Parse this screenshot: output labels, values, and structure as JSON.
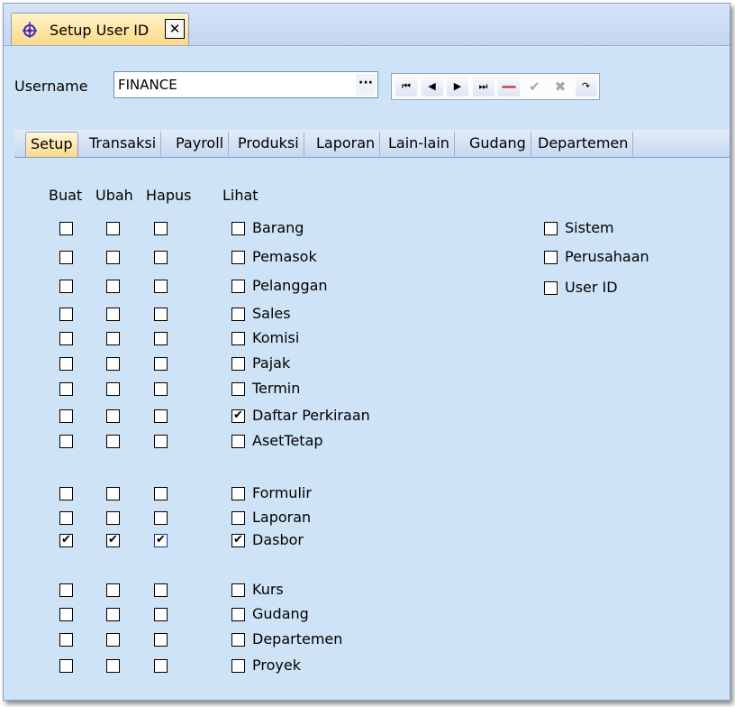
{
  "window": {
    "tab_title": "Setup User ID",
    "close_label": "✕"
  },
  "username": {
    "label": "Username",
    "value": "FINANCE",
    "lookup_label": "···"
  },
  "nav_buttons": [
    {
      "name": "first-record-button",
      "glyph": "⏮",
      "enabled": true
    },
    {
      "name": "prev-record-button",
      "glyph": "◀",
      "enabled": true
    },
    {
      "name": "next-record-button",
      "glyph": "▶",
      "enabled": true
    },
    {
      "name": "last-record-button",
      "glyph": "⏭",
      "enabled": true
    },
    {
      "name": "delete-record-button",
      "glyph": "—",
      "enabled": true
    },
    {
      "name": "save-record-button",
      "glyph": "✔",
      "enabled": false
    },
    {
      "name": "cancel-edit-button",
      "glyph": "✖",
      "enabled": false
    },
    {
      "name": "refresh-button",
      "glyph": "↷",
      "enabled": true
    }
  ],
  "tabs": [
    "Setup",
    "Transaksi",
    "Payroll",
    "Produksi",
    "Laporan",
    "Lain-lain",
    "Gudang",
    "Departemen"
  ],
  "active_tab": "Setup",
  "columns": {
    "buat": "Buat",
    "ubah": "Ubah",
    "hapus": "Hapus",
    "lihat": "Lihat"
  },
  "permissions": [
    {
      "label": "Barang",
      "buat": false,
      "ubah": false,
      "hapus": false,
      "lihat": false
    },
    {
      "label": "Pemasok",
      "buat": false,
      "ubah": false,
      "hapus": false,
      "lihat": false
    },
    {
      "label": "Pelanggan",
      "buat": false,
      "ubah": false,
      "hapus": false,
      "lihat": false
    },
    {
      "label": "Sales",
      "buat": false,
      "ubah": false,
      "hapus": false,
      "lihat": false
    },
    {
      "label": "Komisi",
      "buat": false,
      "ubah": false,
      "hapus": false,
      "lihat": false
    },
    {
      "label": "Pajak",
      "buat": false,
      "ubah": false,
      "hapus": false,
      "lihat": false
    },
    {
      "label": "Termin",
      "buat": false,
      "ubah": false,
      "hapus": false,
      "lihat": false
    },
    {
      "label": "Daftar Perkiraan",
      "buat": false,
      "ubah": false,
      "hapus": false,
      "lihat": true
    },
    {
      "label": "AsetTetap",
      "buat": false,
      "ubah": false,
      "hapus": false,
      "lihat": false
    },
    {
      "label": "Formulir",
      "buat": false,
      "ubah": false,
      "hapus": false,
      "lihat": false
    },
    {
      "label": "Laporan",
      "buat": false,
      "ubah": false,
      "hapus": false,
      "lihat": false
    },
    {
      "label": "Dasbor",
      "buat": true,
      "ubah": true,
      "hapus": true,
      "lihat": true
    },
    {
      "label": "Kurs",
      "buat": false,
      "ubah": false,
      "hapus": false,
      "lihat": false
    },
    {
      "label": "Gudang",
      "buat": false,
      "ubah": false,
      "hapus": false,
      "lihat": false
    },
    {
      "label": "Departemen",
      "buat": false,
      "ubah": false,
      "hapus": false,
      "lihat": false
    },
    {
      "label": "Proyek",
      "buat": false,
      "ubah": false,
      "hapus": false,
      "lihat": false
    }
  ],
  "system_options": [
    {
      "label": "Sistem",
      "checked": false
    },
    {
      "label": "Perusahaan",
      "checked": false
    },
    {
      "label": "User ID",
      "checked": false
    }
  ]
}
